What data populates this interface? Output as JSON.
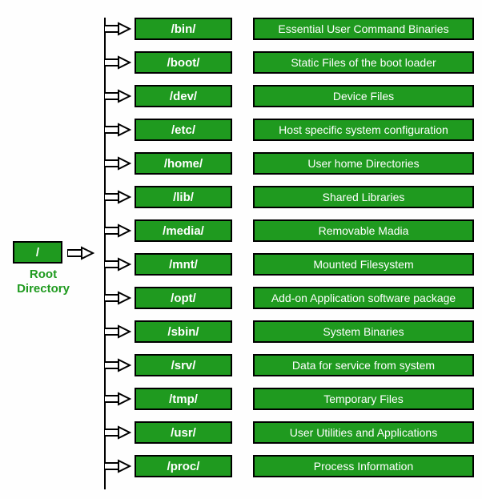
{
  "root": {
    "symbol": "/",
    "label": "Root Directory"
  },
  "rows": [
    {
      "dir": "/bin/",
      "desc": "Essential User Command Binaries"
    },
    {
      "dir": "/boot/",
      "desc": "Static Files of the boot loader"
    },
    {
      "dir": "/dev/",
      "desc": "Device Files"
    },
    {
      "dir": "/etc/",
      "desc": "Host specific system configuration"
    },
    {
      "dir": "/home/",
      "desc": "User home Directories"
    },
    {
      "dir": "/lib/",
      "desc": "Shared Libraries"
    },
    {
      "dir": "/media/",
      "desc": "Removable Madia"
    },
    {
      "dir": "/mnt/",
      "desc": "Mounted Filesystem"
    },
    {
      "dir": "/opt/",
      "desc": "Add-on Application software package"
    },
    {
      "dir": "/sbin/",
      "desc": "System Binaries"
    },
    {
      "dir": "/srv/",
      "desc": "Data for service from system"
    },
    {
      "dir": "/tmp/",
      "desc": "Temporary Files"
    },
    {
      "dir": "/usr/",
      "desc": "User Utilities and Applications"
    },
    {
      "dir": "/proc/",
      "desc": "Process Information"
    }
  ],
  "colors": {
    "green": "#1f9a1f",
    "border": "#000000",
    "text": "#ffffff"
  }
}
